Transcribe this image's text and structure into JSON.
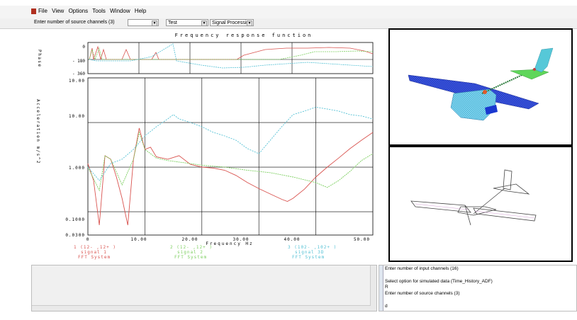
{
  "menu": [
    "File",
    "View",
    "Options",
    "Tools",
    "Window",
    "Help"
  ],
  "toolbar": {
    "prompt": "Enter number of source channels (3)",
    "combo1": "",
    "combo2": "Test",
    "combo3": "Signal Processing"
  },
  "plot": {
    "title": "Frequency  response  function",
    "phase_label": "Phase",
    "phase_ticks": [
      "0",
      "- 180",
      "- 360"
    ],
    "amp_ticks": [
      "10.00",
      "10.00",
      "1.000",
      "0.1000",
      "0.0300"
    ],
    "ylabel": "Acceleration m/s^2",
    "xlabel": "Frequency Hz",
    "x_ticks": [
      "0",
      "10.00",
      "20.00",
      "30.00",
      "40.00",
      "50.00"
    ],
    "legend": [
      {
        "line1": "1  (12- ,12+ )",
        "line2": "signal 1",
        "line3": "FFT System",
        "color": "#d9534f"
      },
      {
        "line1": "2  (12- ,12+ )",
        "line2": "signal 2",
        "line3": "FFT System",
        "color": "#7ccf5f"
      },
      {
        "line1": "3  (102- ,102+ )",
        "line2": "signal 3D",
        "line3": "FFT System",
        "color": "#52c0d4"
      }
    ]
  },
  "chart_data": {
    "type": "line",
    "title": "Frequency  response  function",
    "xlabel": "Frequency Hz",
    "ylabel": "Acceleration m/s^2",
    "xlim": [
      0,
      50
    ],
    "ylim": [
      0.03,
      100
    ],
    "y_scale": "log",
    "grid": true,
    "series": [
      {
        "name": "signal 1",
        "color": "#d9534f",
        "x": [
          0,
          1,
          2,
          3,
          4,
          5,
          6,
          7,
          8,
          9,
          10,
          11,
          12,
          14,
          16,
          18,
          20,
          22,
          24,
          26,
          28,
          30,
          32,
          34,
          35,
          36,
          38,
          40,
          42,
          44,
          46,
          48,
          50
        ],
        "y": [
          1.2,
          0.5,
          0.05,
          1.8,
          1.5,
          0.6,
          0.2,
          0.05,
          1.5,
          7.5,
          2.5,
          2.8,
          1.7,
          1.5,
          1.8,
          1.15,
          1.0,
          0.95,
          0.85,
          0.65,
          0.45,
          0.33,
          0.25,
          0.19,
          0.17,
          0.2,
          0.32,
          0.6,
          1.0,
          1.6,
          2.6,
          4.0,
          6.0
        ]
      },
      {
        "name": "signal 2",
        "color": "#7ccf5f",
        "x": [
          0,
          2,
          3,
          4,
          6,
          8,
          9,
          10,
          12,
          14,
          16,
          18,
          20,
          24,
          28,
          32,
          36,
          40,
          42,
          44,
          46,
          48,
          50
        ],
        "y": [
          1.0,
          0.3,
          1.8,
          1.5,
          0.4,
          1.5,
          6.0,
          2.5,
          1.6,
          1.4,
          1.3,
          1.2,
          1.1,
          1.0,
          0.85,
          0.75,
          0.6,
          0.45,
          0.35,
          0.5,
          0.8,
          1.4,
          2.0
        ]
      },
      {
        "name": "signal 3D",
        "color": "#52c0d4",
        "x": [
          0,
          2,
          4,
          6,
          8,
          10,
          12,
          14,
          15,
          16,
          18,
          20,
          22,
          24,
          26,
          28,
          30,
          32,
          34,
          36,
          38,
          40,
          42,
          44,
          46,
          48,
          50
        ],
        "y": [
          1.0,
          0.5,
          1.2,
          1.5,
          2.5,
          5.0,
          8.0,
          12.0,
          15.0,
          12.0,
          10.0,
          8.0,
          6.0,
          5.0,
          4.0,
          2.6,
          2.0,
          4.0,
          8.0,
          15.0,
          18.0,
          22.0,
          20.0,
          18.0,
          15.0,
          14.0,
          12.0
        ]
      }
    ]
  },
  "console": {
    "lines": [
      "Enter number of input channels (16)",
      "",
      "Select option for simulated data (Time_History_ADF)",
      "R",
      "Enter number of source channels (3)",
      "",
      "d"
    ]
  }
}
